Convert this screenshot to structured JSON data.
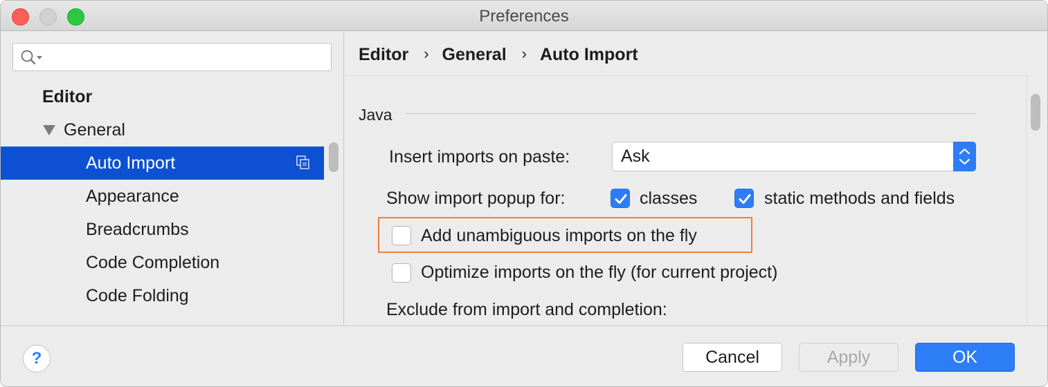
{
  "window": {
    "title": "Preferences"
  },
  "search": {
    "value": "",
    "placeholder": ""
  },
  "sidebar": {
    "items": [
      {
        "label": "Editor",
        "level": 0,
        "selected": false
      },
      {
        "label": "General",
        "level": 1,
        "expanded": true,
        "selected": false
      },
      {
        "label": "Auto Import",
        "level": 2,
        "selected": true
      },
      {
        "label": "Appearance",
        "level": 2,
        "selected": false
      },
      {
        "label": "Breadcrumbs",
        "level": 2,
        "selected": false
      },
      {
        "label": "Code Completion",
        "level": 2,
        "selected": false
      },
      {
        "label": "Code Folding",
        "level": 2,
        "selected": false
      }
    ]
  },
  "breadcrumb": {
    "items": [
      "Editor",
      "General",
      "Auto Import"
    ],
    "separator": "›"
  },
  "section": {
    "title": "Java"
  },
  "insert_imports": {
    "label": "Insert imports on paste:",
    "value": "Ask"
  },
  "import_popup": {
    "label": "Show import popup for:",
    "classes": {
      "label": "classes",
      "checked": true
    },
    "static_methods": {
      "label": "static methods and fields",
      "checked": true
    }
  },
  "add_unambiguous": {
    "label": "Add unambiguous imports on the fly",
    "checked": false
  },
  "optimize_imports": {
    "label": "Optimize imports on the fly (for current project)",
    "checked": false
  },
  "exclude": {
    "label": "Exclude from import and completion:"
  },
  "footer": {
    "help_label": "?",
    "cancel_label": "Cancel",
    "apply_label": "Apply",
    "ok_label": "OK"
  },
  "colors": {
    "selection": "#0d50d3",
    "accent": "#2c7df6",
    "highlight": "#f07f3a",
    "close": "#fe5f57",
    "maximize": "#2bc840"
  }
}
